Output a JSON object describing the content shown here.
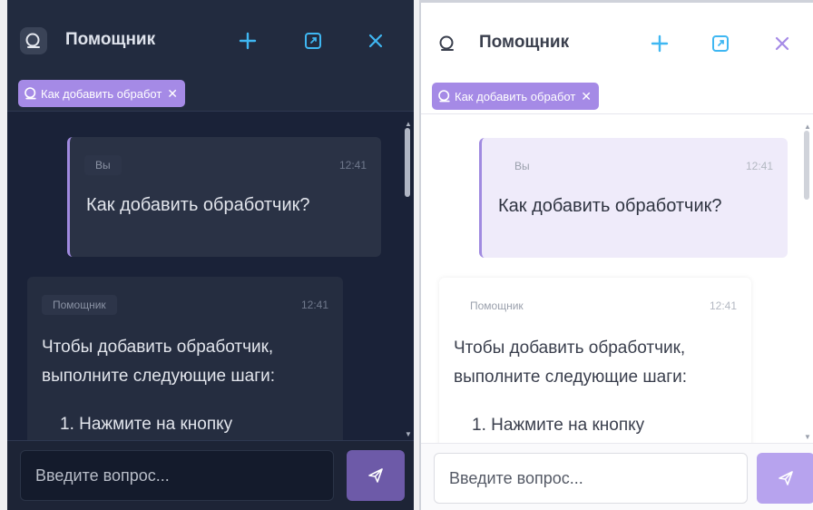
{
  "assistant": {
    "title": "Помощник",
    "chip_label": "Как добавить обработ",
    "chip_close": "✕",
    "close_glyph": "✕",
    "plus_glyph": "+",
    "user_tag": "Вы",
    "bot_tag": "Помощник",
    "user_time": "12:41",
    "bot_time": "12:41",
    "user_message": "Как добавить обработчик?",
    "bot_line1": "Чтобы добавить обработчик,",
    "bot_line2": "выполните следующие шаги:",
    "bot_step1": "1. Нажмите на кнопку",
    "input_placeholder": "Введите вопрос...",
    "icons": [
      "chat-icon",
      "plus-icon",
      "expand-icon",
      "close-icon",
      "send-icon"
    ]
  },
  "themes": {
    "dark": {
      "background": "#1a2238",
      "accent": "#a58ae6",
      "send": "#6d5aa8"
    },
    "light": {
      "background": "#ffffff",
      "accent": "#a58ae6",
      "send": "#b7a3ee"
    }
  }
}
